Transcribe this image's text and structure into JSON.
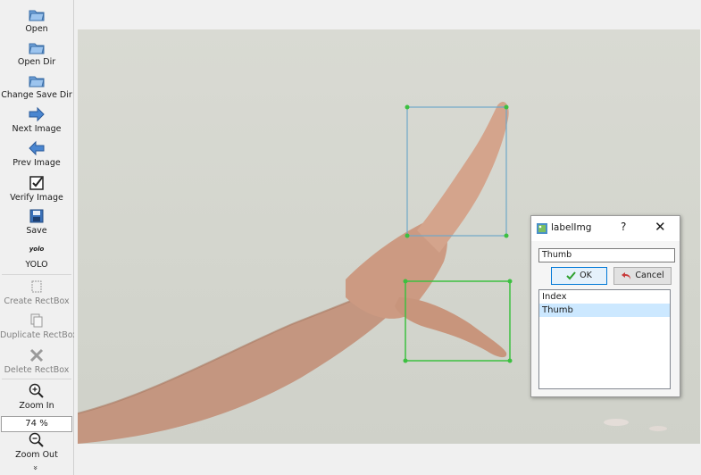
{
  "toolbar": {
    "open": "Open",
    "open_dir": "Open Dir",
    "change_save_dir": "Change Save Dir",
    "next_image": "Next Image",
    "prev_image": "Prev Image",
    "verify_image": "Verify Image",
    "save": "Save",
    "format_icon_text": "yolo",
    "format": "YOLO",
    "create_rectbox": "Create RectBox",
    "duplicate_rectbox": "Duplicate RectBox",
    "delete_rectbox": "Delete RectBox",
    "zoom_in": "Zoom In",
    "zoom_value": "74 %",
    "zoom_out": "Zoom Out",
    "more": "»"
  },
  "dialog": {
    "title": "labelImg",
    "help": "?",
    "close": "✕",
    "input_value": "Thumb",
    "ok_label": "OK",
    "cancel_label": "Cancel",
    "labels": [
      "Index",
      "Thumb"
    ],
    "selected_label": "Thumb"
  },
  "colors": {
    "box_index": "#6fa8c8",
    "box_thumb": "#3cc040",
    "accent": "#0078d7",
    "selection": "#cce8ff"
  }
}
